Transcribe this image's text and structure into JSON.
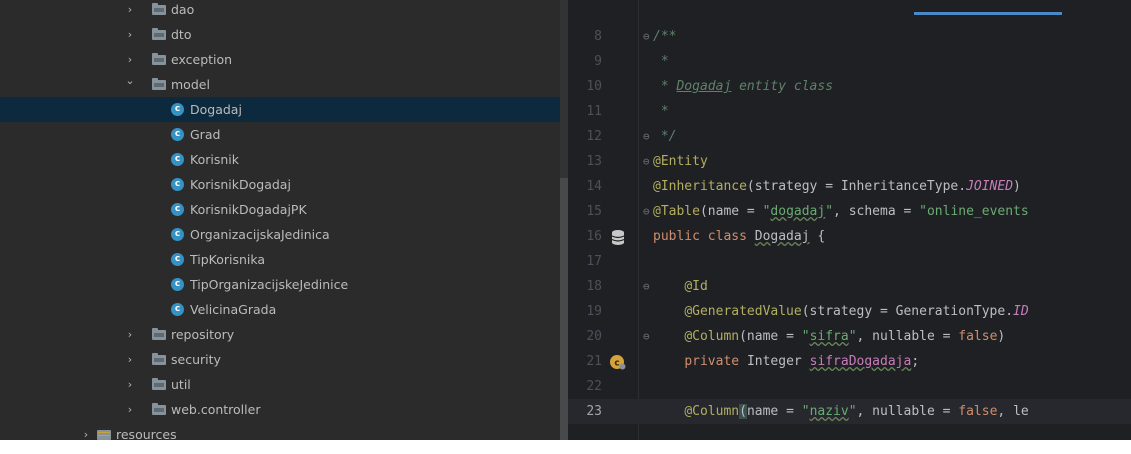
{
  "project_tree": {
    "items": [
      {
        "label": "dao",
        "kind": "package",
        "expanded": false,
        "level": 1
      },
      {
        "label": "dto",
        "kind": "package",
        "expanded": false,
        "level": 1
      },
      {
        "label": "exception",
        "kind": "package",
        "expanded": false,
        "level": 1
      },
      {
        "label": "model",
        "kind": "package",
        "expanded": true,
        "level": 1
      },
      {
        "label": "Dogadaj",
        "kind": "class",
        "level": 2,
        "selected": true
      },
      {
        "label": "Grad",
        "kind": "class",
        "level": 2
      },
      {
        "label": "Korisnik",
        "kind": "class",
        "level": 2
      },
      {
        "label": "KorisnikDogadaj",
        "kind": "class",
        "level": 2
      },
      {
        "label": "KorisnikDogadajPK",
        "kind": "class",
        "level": 2
      },
      {
        "label": "OrganizacijskaJedinica",
        "kind": "class",
        "level": 2
      },
      {
        "label": "TipKorisnika",
        "kind": "class",
        "level": 2
      },
      {
        "label": "TipOrganizacijskeJedinice",
        "kind": "class",
        "level": 2
      },
      {
        "label": "VelicinaGrada",
        "kind": "class",
        "level": 2
      },
      {
        "label": "repository",
        "kind": "package",
        "expanded": false,
        "level": 1
      },
      {
        "label": "security",
        "kind": "package",
        "expanded": false,
        "level": 1
      },
      {
        "label": "util",
        "kind": "package",
        "expanded": false,
        "level": 1
      },
      {
        "label": "web.controller",
        "kind": "package",
        "expanded": false,
        "level": 1
      },
      {
        "label": "resources",
        "kind": "resource-folder",
        "expanded": false,
        "level": 0
      }
    ]
  },
  "editor": {
    "current_line": "23",
    "lines": [
      {
        "n": "8",
        "fold": "⊖",
        "tokens": [
          [
            "doc",
            "/**"
          ]
        ]
      },
      {
        "n": "9",
        "fold": "",
        "tokens": [
          [
            "doc",
            " *"
          ]
        ]
      },
      {
        "n": "10",
        "fold": "",
        "tokens": [
          [
            "doc",
            " * "
          ],
          [
            "docref",
            "Dogadaj"
          ],
          [
            "doc",
            " entity class"
          ]
        ]
      },
      {
        "n": "11",
        "fold": "",
        "tokens": [
          [
            "doc",
            " *"
          ]
        ]
      },
      {
        "n": "12",
        "fold": "⊖",
        "tokens": [
          [
            "doc",
            " */"
          ]
        ]
      },
      {
        "n": "13",
        "fold": "⊖",
        "tokens": [
          [
            "ann",
            "@Entity"
          ]
        ]
      },
      {
        "n": "14",
        "fold": "",
        "tokens": [
          [
            "ann",
            "@Inheritance"
          ],
          [
            "plain",
            "(strategy = InheritanceType."
          ],
          [
            "const",
            "JOINED"
          ],
          [
            "plain",
            ")"
          ]
        ]
      },
      {
        "n": "15",
        "fold": "⊖",
        "tokens": [
          [
            "ann",
            "@Table"
          ],
          [
            "plain",
            "(name = "
          ],
          [
            "str",
            "\""
          ],
          [
            "strtypo",
            "dogadaj"
          ],
          [
            "str",
            "\""
          ],
          [
            "plain",
            ", schema = "
          ],
          [
            "str",
            "\"online_events"
          ]
        ]
      },
      {
        "n": "16",
        "fold": "",
        "icon": "database-icon",
        "tokens": [
          [
            "kw",
            "public class "
          ],
          [
            "typo",
            "Dogadaj"
          ],
          [
            "plain",
            " {"
          ]
        ]
      },
      {
        "n": "17",
        "fold": "",
        "tokens": []
      },
      {
        "n": "18",
        "fold": "⊖",
        "tokens": [
          [
            "plain",
            "    "
          ],
          [
            "ann",
            "@Id"
          ]
        ]
      },
      {
        "n": "19",
        "fold": "",
        "tokens": [
          [
            "plain",
            "    "
          ],
          [
            "ann",
            "@GeneratedValue"
          ],
          [
            "plain",
            "(strategy = GenerationType."
          ],
          [
            "const",
            "ID"
          ]
        ]
      },
      {
        "n": "20",
        "fold": "⊖",
        "tokens": [
          [
            "plain",
            "    "
          ],
          [
            "ann",
            "@Column"
          ],
          [
            "plain",
            "(name = "
          ],
          [
            "str",
            "\""
          ],
          [
            "strtypo",
            "sifra"
          ],
          [
            "str",
            "\""
          ],
          [
            "plain",
            ", nullable = "
          ],
          [
            "kw",
            "false"
          ],
          [
            "plain",
            ")"
          ]
        ]
      },
      {
        "n": "21",
        "fold": "",
        "icon": "bean-icon",
        "tokens": [
          [
            "plain",
            "    "
          ],
          [
            "kw",
            "private "
          ],
          [
            "plain",
            "Integer "
          ],
          [
            "fieldtypo",
            "sifraDogadaja"
          ],
          [
            "plain",
            ";"
          ]
        ]
      },
      {
        "n": "22",
        "fold": "",
        "tokens": []
      },
      {
        "n": "23",
        "fold": "",
        "tokens": [
          [
            "plain",
            "    "
          ],
          [
            "ann",
            "@Column"
          ],
          [
            "paren",
            "("
          ],
          [
            "plain",
            "name = "
          ],
          [
            "str",
            "\""
          ],
          [
            "strtypo",
            "naziv"
          ],
          [
            "str",
            "\""
          ],
          [
            "plain",
            ", nullable = "
          ],
          [
            "kw",
            "false"
          ],
          [
            "plain",
            ", le"
          ]
        ]
      }
    ]
  },
  "colors": {
    "tree_bg": "#2b2b2b",
    "tree_selected": "#0d293e",
    "editor_bg": "#1f2023",
    "annotation": "#b3ae60",
    "keyword": "#cf8e6d",
    "string": "#6aab73",
    "doc_comment": "#5f826b",
    "constant": "#c77dbb",
    "class_icon": "#3592c4"
  }
}
